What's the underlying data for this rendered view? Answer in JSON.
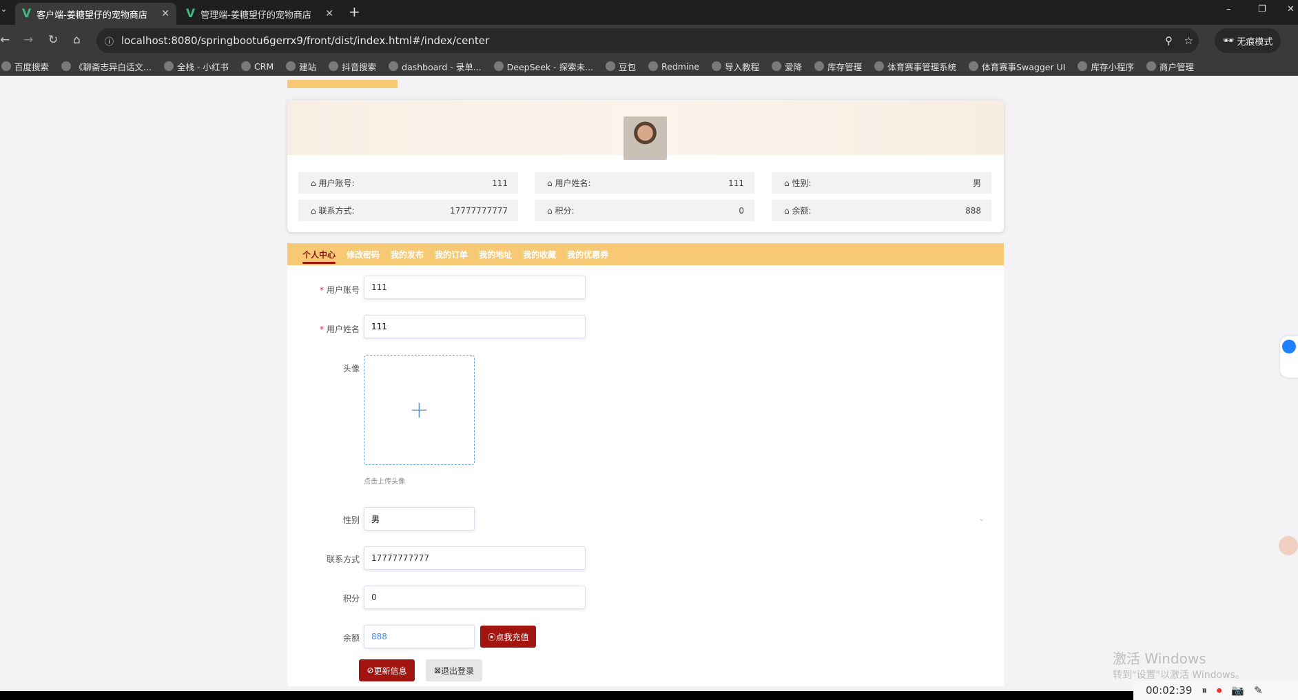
{
  "browser": {
    "tabs": [
      {
        "title": "客户端-姜糖望仔的宠物商店",
        "active": true
      },
      {
        "title": "管理端-姜糖望仔的宠物商店",
        "active": false
      }
    ],
    "url": "localhost:8080/springbootu6gerrx9/front/dist/index.html#/index/center",
    "incognito_label": "无痕模式",
    "bookmarks": [
      "百度搜索",
      "《聊斋志异白话文...",
      "全栈 - 小红书",
      "CRM",
      "建站",
      "抖音搜索",
      "dashboard - 录单...",
      "DeepSeek - 探索未...",
      "豆包",
      "Redmine",
      "导入教程",
      "爱降",
      "库存管理",
      "体育赛事管理系统",
      "体育赛事Swagger UI",
      "库存小程序",
      "商户管理"
    ]
  },
  "profile": {
    "info": [
      {
        "label": "用户账号:",
        "value": "111"
      },
      {
        "label": "用户姓名:",
        "value": "111"
      },
      {
        "label": "性别:",
        "value": "男"
      },
      {
        "label": "联系方式:",
        "value": "17777777777"
      },
      {
        "label": "积分:",
        "value": "0"
      },
      {
        "label": "余额:",
        "value": "888"
      }
    ]
  },
  "menu": [
    "个人中心",
    "修改密码",
    "我的发布",
    "我的订单",
    "我的地址",
    "我的收藏",
    "我的优惠券"
  ],
  "form": {
    "account_label": "用户账号",
    "account_value": "111",
    "name_label": "用户姓名",
    "name_value": "111",
    "avatar_label": "头像",
    "avatar_hint": "点击上传头像",
    "gender_label": "性别",
    "gender_value": "男",
    "phone_label": "联系方式",
    "phone_value": "17777777777",
    "points_label": "积分",
    "points_value": "0",
    "balance_label": "余额",
    "balance_value": "888",
    "recharge_button": "点我充值",
    "update_button": "更新信息",
    "logout_button": "退出登录"
  },
  "watermark": {
    "line1": "激活 Windows",
    "line2": "转到\"设置\"以激活 Windows。"
  },
  "recorder": {
    "time": "00:02:39"
  }
}
